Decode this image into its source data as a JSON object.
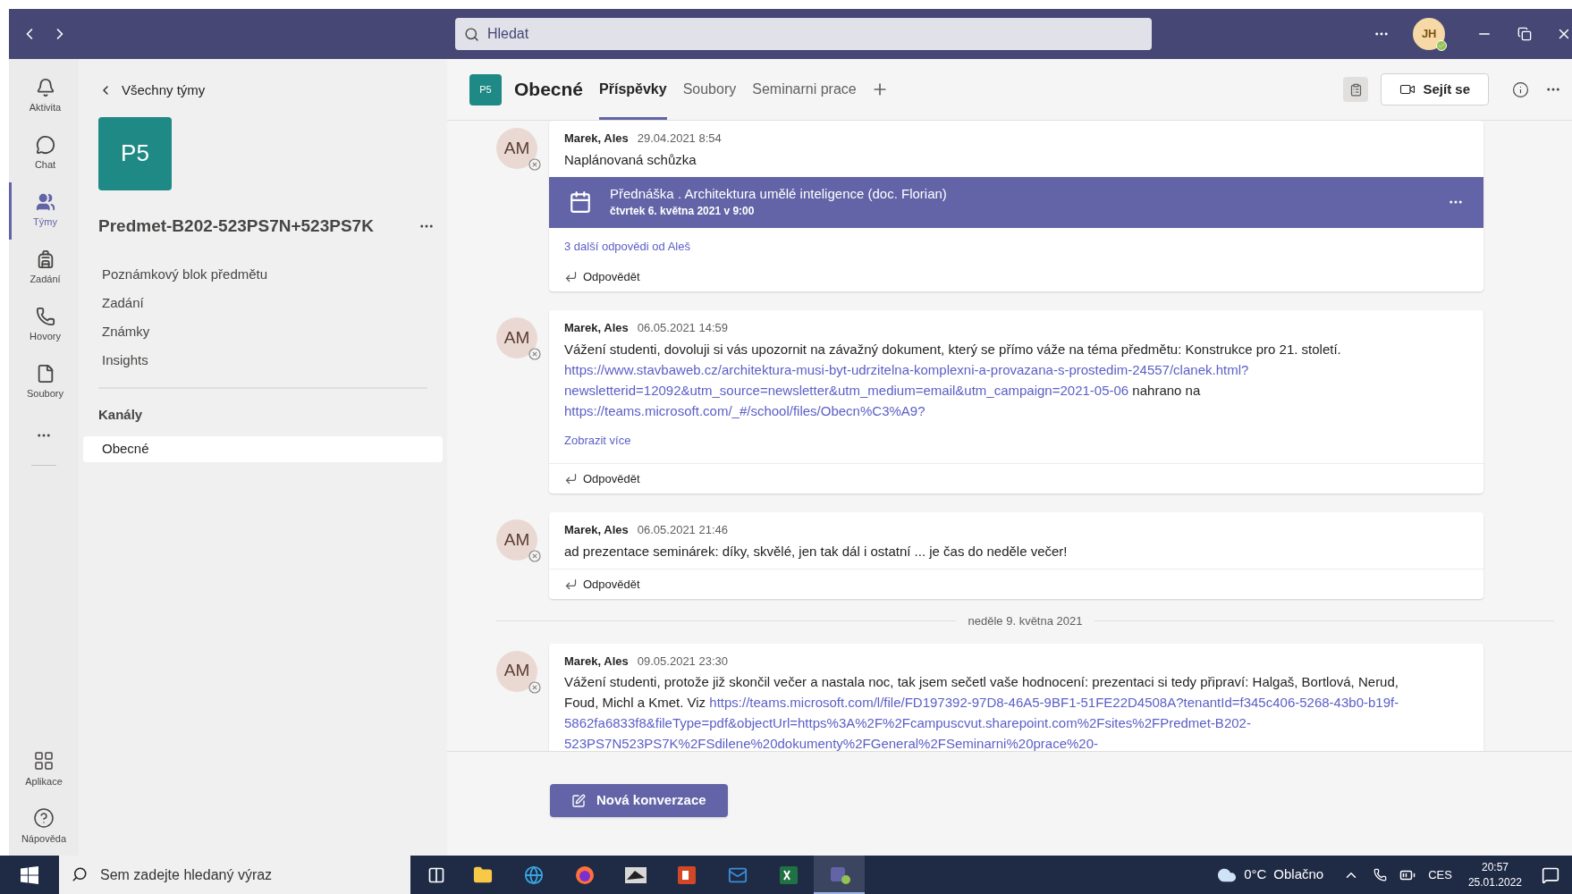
{
  "title_bar": {
    "search": {
      "placeholder": "Hledat"
    },
    "avatar": {
      "initials": "JH"
    }
  },
  "rail": {
    "items": [
      {
        "label": "Aktivita",
        "selected": false
      },
      {
        "label": "Chat",
        "selected": false
      },
      {
        "label": "Týmy",
        "selected": true
      },
      {
        "label": "Zadání",
        "selected": false
      },
      {
        "label": "Hovory",
        "selected": false
      },
      {
        "label": "Soubory",
        "selected": false
      }
    ],
    "bottom_items": [
      {
        "label": "Aplikace"
      },
      {
        "label": "Nápověda"
      }
    ]
  },
  "team_panel": {
    "back_label": "Všechny týmy",
    "team_tile": "P5",
    "team_name": "Predmet-B202-523PS7N+523PS7K",
    "menu_items": [
      "Poznámkový blok předmětu",
      "Zadání",
      "Známky",
      "Insights"
    ],
    "section": "Kanály",
    "channels": [
      {
        "label": "Obecné",
        "selected": true
      }
    ]
  },
  "channel_header": {
    "tile": "P5",
    "title": "Obecné",
    "tabs": [
      {
        "label": "Příspěvky",
        "selected": true
      },
      {
        "label": "Soubory",
        "selected": false
      },
      {
        "label": "Seminarni prace",
        "selected": false
      }
    ],
    "meet_button": "Sejít se"
  },
  "messages": [
    {
      "kind": "post",
      "initials": "AM",
      "author": "Marek, Ales",
      "time": "29.04.2021 8:54",
      "lines": [
        [
          {
            "kind": "text",
            "text": "Naplánovaná schůzka"
          }
        ]
      ],
      "meeting": {
        "title": "Přednáška . Architektura umělé inteligence (doc. Florian)",
        "subtitle": "čtvrtek 6. května 2021 v 9:00"
      },
      "replies_link": "3 další odpovědi od Aleš",
      "reply": "Odpovědět"
    },
    {
      "kind": "post",
      "initials": "AM",
      "author": "Marek, Ales",
      "time": "06.05.2021 14:59",
      "lines": [
        [
          {
            "kind": "text",
            "text": "Vážení studenti, dovoluji si vás upozornit na závažný dokument, který se přímo váže na téma předmětu: Konstrukce pro 21. století."
          }
        ],
        [
          {
            "kind": "link",
            "text": "https://www.stavbaweb.cz/architektura-musi-byt-udrzitelna-komplexni-a-provazana-s-prostedim-24557/clanek.html?"
          }
        ],
        [
          {
            "kind": "link",
            "text": "newsletterid=12092&utm_source=newsletter&utm_medium=email&utm_campaign=2021-05-06"
          },
          {
            "kind": "text",
            "text": " nahrano na"
          }
        ],
        [
          {
            "kind": "link",
            "text": "https://teams.microsoft.com/_#/school/files/Obecn%C3%A9?"
          }
        ]
      ],
      "show_more": "Zobrazit více",
      "reply": "Odpovědět"
    },
    {
      "kind": "post",
      "initials": "AM",
      "author": "Marek, Ales",
      "time": "06.05.2021 21:46",
      "lines": [
        [
          {
            "kind": "text",
            "text": "ad prezentace seminárek: díky, skvělé, jen tak dál i ostatní ... je čas do neděle večer!"
          }
        ]
      ],
      "reply": "Odpovědět"
    },
    {
      "kind": "date_divider",
      "text": "neděle 9. května 2021"
    },
    {
      "kind": "post",
      "initials": "AM",
      "author": "Marek, Ales",
      "time": "09.05.2021 23:30",
      "lines": [
        [
          {
            "kind": "text",
            "text": "Vážení studenti, protože již skončil večer a nastala noc, tak jsem sečetl vaše hodnocení: prezentaci si tedy připraví: Halgaš, Bortlová, Nerud,"
          }
        ],
        [
          {
            "kind": "text",
            "text": "Foud, Michl a Kmet. Viz "
          },
          {
            "kind": "link",
            "text": "https://teams.microsoft.com/l/file/FD197392-97D8-46A5-9BF1-51FE22D4508A?tenantId=f345c406-5268-43b0-b19f-"
          }
        ],
        [
          {
            "kind": "link",
            "text": "5862fa6833f8&fileType=pdf&objectUrl=https%3A%2F%2Fcampuscvut.sharepoint.com%2Fsites%2FPredmet-B202-"
          }
        ],
        [
          {
            "kind": "link",
            "text": "523PS7N523PS7K%2FSdilene%20dokumenty%2FGeneral%2FSeminarni%20prace%20-"
          }
        ]
      ]
    }
  ],
  "new_conversation_button": "Nová konverzace",
  "taskbar": {
    "search": {
      "placeholder": "Sem zadejte hledaný výraz"
    },
    "apps": [
      {
        "selected": false
      },
      {
        "selected": false
      },
      {
        "selected": false
      },
      {
        "selected": false
      },
      {
        "selected": false
      },
      {
        "selected": false
      },
      {
        "selected": false
      },
      {
        "selected": true
      }
    ],
    "temperature": "0°C",
    "weather": "Oblačno",
    "language": "CES",
    "time": "20:57",
    "date": "25.01.2022"
  }
}
